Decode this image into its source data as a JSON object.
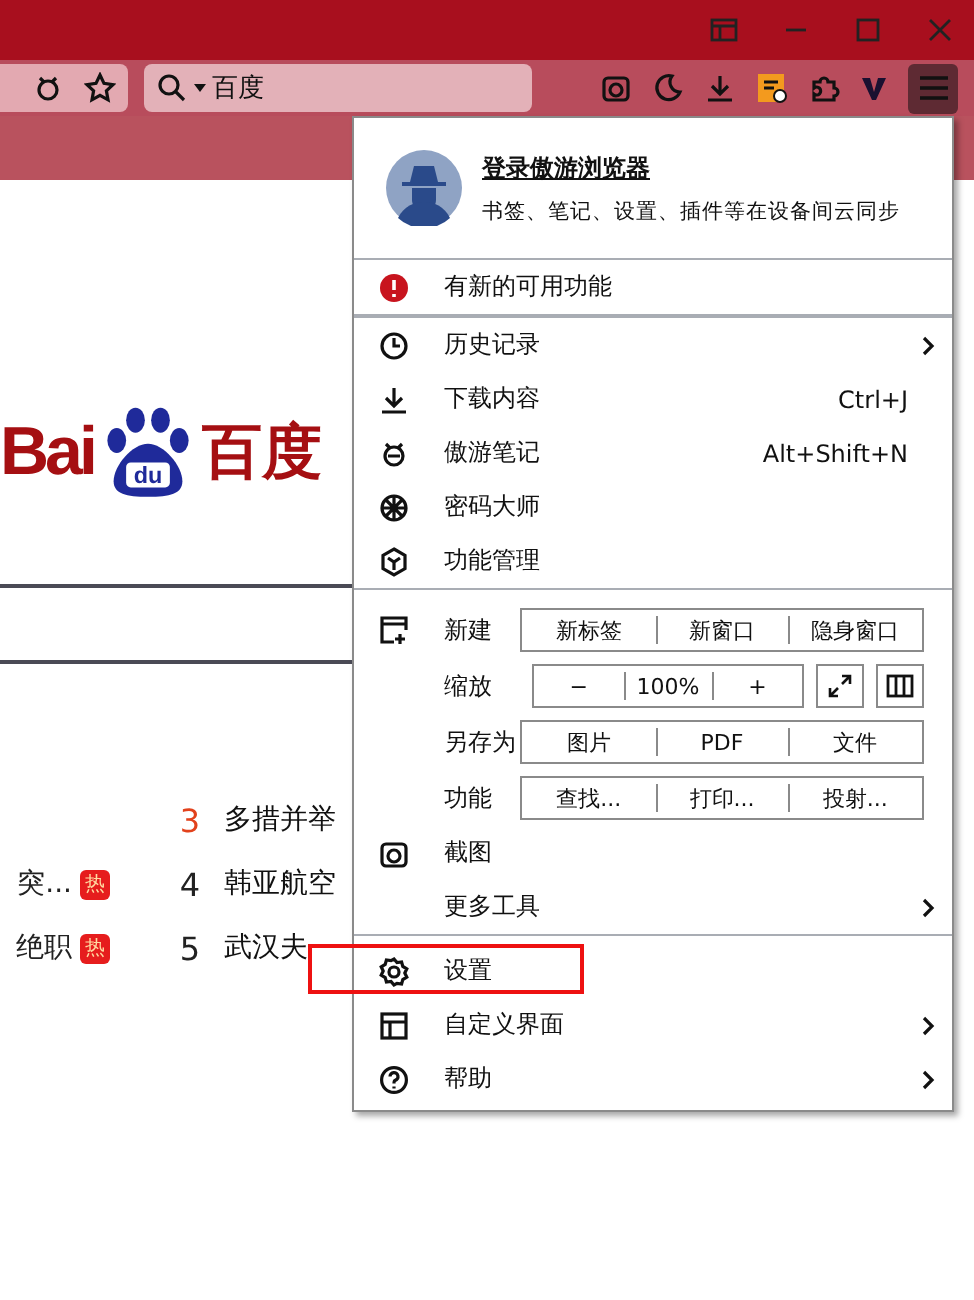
{
  "address_bar": {
    "value": "百度"
  },
  "page": {
    "logo": {
      "latin": "Bai",
      "paw": "du",
      "chinese": "百度"
    },
    "hot_list": [
      {
        "rank": "3",
        "color": "#e2421c",
        "title": "多措并举"
      },
      {
        "left_title": "突...",
        "left_badge": "热",
        "rank": "4",
        "color": "#222222",
        "title": "韩亚航空"
      },
      {
        "left_title": "绝职",
        "left_badge": "热",
        "rank": "5",
        "color": "#222222",
        "title": "武汉夫"
      }
    ]
  },
  "menu": {
    "account": {
      "title": "登录傲游浏览器",
      "subtitle": "书签、笔记、设置、插件等在设备间云同步"
    },
    "notice": {
      "label": "有新的可用功能"
    },
    "group_1": [
      {
        "label": "历史记录",
        "submenu": true
      },
      {
        "label": "下载内容",
        "submenu": false,
        "shortcut": "Ctrl+J"
      },
      {
        "label": "傲游笔记",
        "submenu": false,
        "shortcut": "Alt+Shift+N"
      },
      {
        "label": "密码大师",
        "submenu": false
      },
      {
        "label": "功能管理",
        "submenu": false
      }
    ],
    "tool_rows": [
      {
        "label": "新建",
        "buttons": [
          "新标签",
          "新窗口",
          "隐身窗口"
        ],
        "extra": false
      },
      {
        "label": "缩放",
        "buttons": [
          "−",
          "100%",
          "+"
        ],
        "extra": true
      },
      {
        "label": "另存为",
        "buttons": [
          "图片",
          "PDF",
          "文件"
        ],
        "extra": false
      },
      {
        "label": "功能",
        "buttons": [
          "查找...",
          "打印...",
          "投射..."
        ],
        "extra": false
      }
    ],
    "group_2": [
      {
        "label": "截图",
        "submenu": false
      },
      {
        "label": "更多工具",
        "submenu": true
      }
    ],
    "group_3": [
      {
        "label": "设置",
        "submenu": false,
        "highlighted": true
      },
      {
        "label": "自定义界面",
        "submenu": true,
        "highlighted": false
      },
      {
        "label": "帮助",
        "submenu": true,
        "highlighted": false
      }
    ]
  }
}
